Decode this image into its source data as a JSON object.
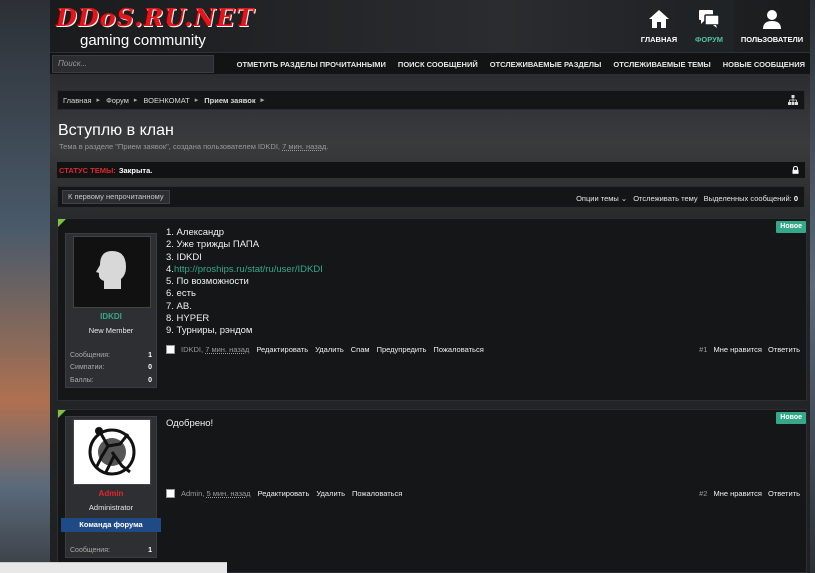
{
  "logo": {
    "text": "DDoS.RU.NET",
    "subtitle": "gaming community"
  },
  "nav": {
    "home": "ГЛАВНАЯ",
    "forum": "ФОРУМ",
    "users": "ПОЛЬЗОВАТЕЛИ"
  },
  "search": {
    "placeholder": "Поиск..."
  },
  "subnav": [
    "ОТМЕТИТЬ РАЗДЕЛЫ ПРОЧИТАННЫМИ",
    "ПОИСК СООБЩЕНИЙ",
    "ОТСЛЕЖИВАЕМЫЕ РАЗДЕЛЫ",
    "ОТСЛЕЖИВАЕМЫЕ ТЕМЫ",
    "НОВЫЕ СООБЩЕНИЯ"
  ],
  "breadcrumb": [
    "Главная",
    "Форум",
    "ВОЕНКОМАТ",
    "Прием заявок"
  ],
  "thread": {
    "title": "Вступлю в клан",
    "desc_prefix": "Тема в разделе \"Прием заявок\", создана пользователем IDKDI,",
    "desc_time": "7 мин. назад",
    "status_label": "СТАТУС ТЕМЫ:",
    "status_value": "Закрыта."
  },
  "toolbar": {
    "first_unread": "К первому непрочитанному",
    "options": "Опции темы",
    "watch": "Отслеживать тему",
    "selected": "Выделенных сообщений:",
    "selected_count": "0"
  },
  "posts": [
    {
      "badge": "Новое",
      "user": {
        "name": "IDKDI",
        "title": "New Member",
        "name_color": "#35a889"
      },
      "stats": [
        {
          "label": "Сообщения:",
          "value": "1"
        },
        {
          "label": "Симпатии:",
          "value": "0"
        },
        {
          "label": "Баллы:",
          "value": "0"
        }
      ],
      "lines": [
        "1. Александр",
        "2. Уже трижды ПАПА",
        "3. IDKDI",
        "4.",
        "5. По возможности",
        "6. есть",
        "7. АВ.",
        "8. HYPER",
        "9. Турниры, рэндом"
      ],
      "link": "http://proships.ru/stat/ru/user/IDKDI",
      "footer": {
        "author": "IDKDI,",
        "time": "7 мин. назад",
        "actions": [
          "Редактировать",
          "Удалить",
          "Спам",
          "Предупредить",
          "Пожаловаться"
        ],
        "num": "#1",
        "like": "Мне нравится",
        "reply": "Ответить"
      }
    },
    {
      "badge": "Новое",
      "user": {
        "name": "Admin",
        "title": "Administrator",
        "banner": "Команда форума",
        "name_color": "#e0262d"
      },
      "stats": [
        {
          "label": "Сообщения:",
          "value": "1"
        }
      ],
      "text": "Одобрено!",
      "footer": {
        "author": "Admin,",
        "time": "5 мин. назад",
        "actions": [
          "Редактировать",
          "Удалить",
          "Пожаловаться"
        ],
        "num": "#2",
        "like": "Мне нравится",
        "reply": "Ответить"
      }
    }
  ],
  "colors": {
    "accent": "#35a889",
    "status_red": "#e0262d",
    "banner_blue": "#1f4a86",
    "corner_green": "#7dc142"
  }
}
